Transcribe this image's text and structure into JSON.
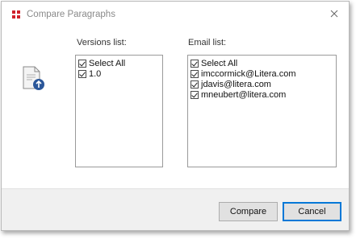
{
  "window": {
    "title": "Compare Paragraphs"
  },
  "versions": {
    "label": "Versions list:",
    "items": [
      {
        "label": "Select All",
        "checked": true
      },
      {
        "label": "1.0",
        "checked": true
      }
    ]
  },
  "emails": {
    "label": "Email list:",
    "items": [
      {
        "label": "Select All",
        "checked": true
      },
      {
        "label": "imccormick@Litera.com",
        "checked": true
      },
      {
        "label": "jdavis@litera.com",
        "checked": true
      },
      {
        "label": "mneubert@litera.com",
        "checked": true
      }
    ]
  },
  "buttons": {
    "compare": "Compare",
    "cancel": "Cancel"
  },
  "colors": {
    "accent": "#0078d7",
    "brand": "#d0202a",
    "icon_blue": "#2b579a"
  }
}
